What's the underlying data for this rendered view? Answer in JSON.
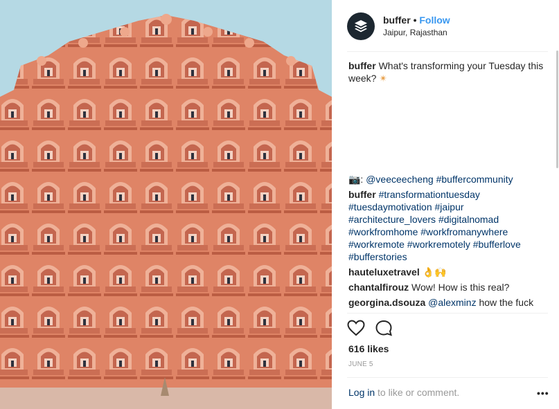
{
  "post": {
    "username": "buffer",
    "separator": "•",
    "follow_label": "Follow",
    "location": "Jaipur, Rajasthan"
  },
  "caption": {
    "user": "buffer",
    "text": "What's transforming your Tuesday this week?",
    "emoji": "✴",
    "credit_prefix": "📷:",
    "credit_tags": "@veeceecheng #buffercommunity"
  },
  "comments": [
    {
      "user": "buffer",
      "text": "#transformationtuesday #tuesdaymotivation #jaipur #architecture_lovers #digitalnomad #workfromhome #workfromanywhere #workremote #workremotely #bufferlove #bufferstories"
    },
    {
      "user": "hauteluxetravel",
      "text": "👌🙌"
    },
    {
      "user": "chantalfirouz",
      "text": "Wow! How is this real?"
    },
    {
      "user": "georgina.dsouza",
      "text_tag": "@alexminz",
      "text": "how the fuck"
    }
  ],
  "likes": "616 likes",
  "date": "JUNE 5",
  "footer": {
    "login_label": "Log in",
    "rest": "to like or comment.",
    "more": "•••"
  },
  "icons": [
    "buffer-logo-icon",
    "heart-icon",
    "comment-icon",
    "more-options-icon"
  ],
  "colors": {
    "accent": "#3897f0",
    "link": "#003569",
    "sky": "#b5d9e4",
    "facade": "#e0876a"
  }
}
